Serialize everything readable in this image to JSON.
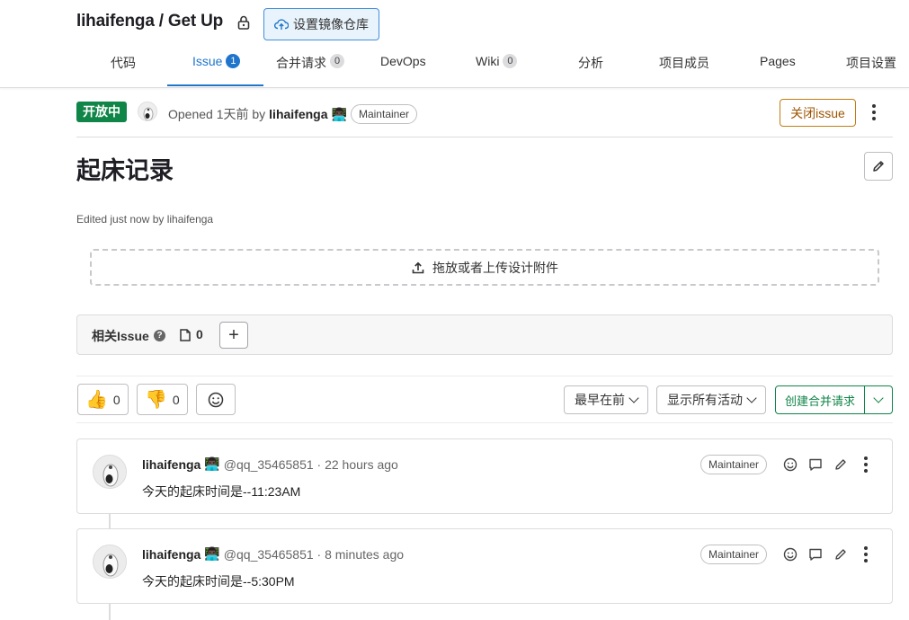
{
  "header": {
    "project_path": "lihaifenga / Get Up",
    "mirror_button": "设置镜像仓库",
    "tabs": [
      {
        "label": "代码"
      },
      {
        "label": "Issue",
        "count": "1"
      },
      {
        "label": "合并请求",
        "count": "0"
      },
      {
        "label": "DevOps"
      },
      {
        "label": "Wiki",
        "count": "0"
      },
      {
        "label": "分析"
      },
      {
        "label": "项目成员"
      },
      {
        "label": "Pages"
      },
      {
        "label": "项目设置"
      }
    ]
  },
  "issue": {
    "status": "开放中",
    "opened_prefix": "Opened 1天前 by",
    "author": "lihaifenga",
    "author_role": "Maintainer",
    "close_button": "关闭issue",
    "title": "起床记录",
    "edited_note": "Edited just now by lihaifenga",
    "upload_text": "拖放或者上传设计附件"
  },
  "related": {
    "label": "相关Issue",
    "count": "0"
  },
  "reactions": {
    "thumbs_up": "0",
    "thumbs_down": "0"
  },
  "controls": {
    "sort": "最早在前",
    "filter": "显示所有活动",
    "create_mr": "创建合并请求"
  },
  "notes": [
    {
      "author": "lihaifenga",
      "meta": "@qq_35465851 · 22 hours ago",
      "role": "Maintainer",
      "body": "今天的起床时间是--11:23AM"
    },
    {
      "author": "lihaifenga",
      "meta": "@qq_35465851 · 8 minutes ago",
      "role": "Maintainer",
      "body": "今天的起床时间是--5:30PM"
    }
  ],
  "colors": {
    "accent": "#1f75cb",
    "open_badge": "#108548",
    "close_btn": "#c17d10",
    "create_mr": "#108548"
  }
}
